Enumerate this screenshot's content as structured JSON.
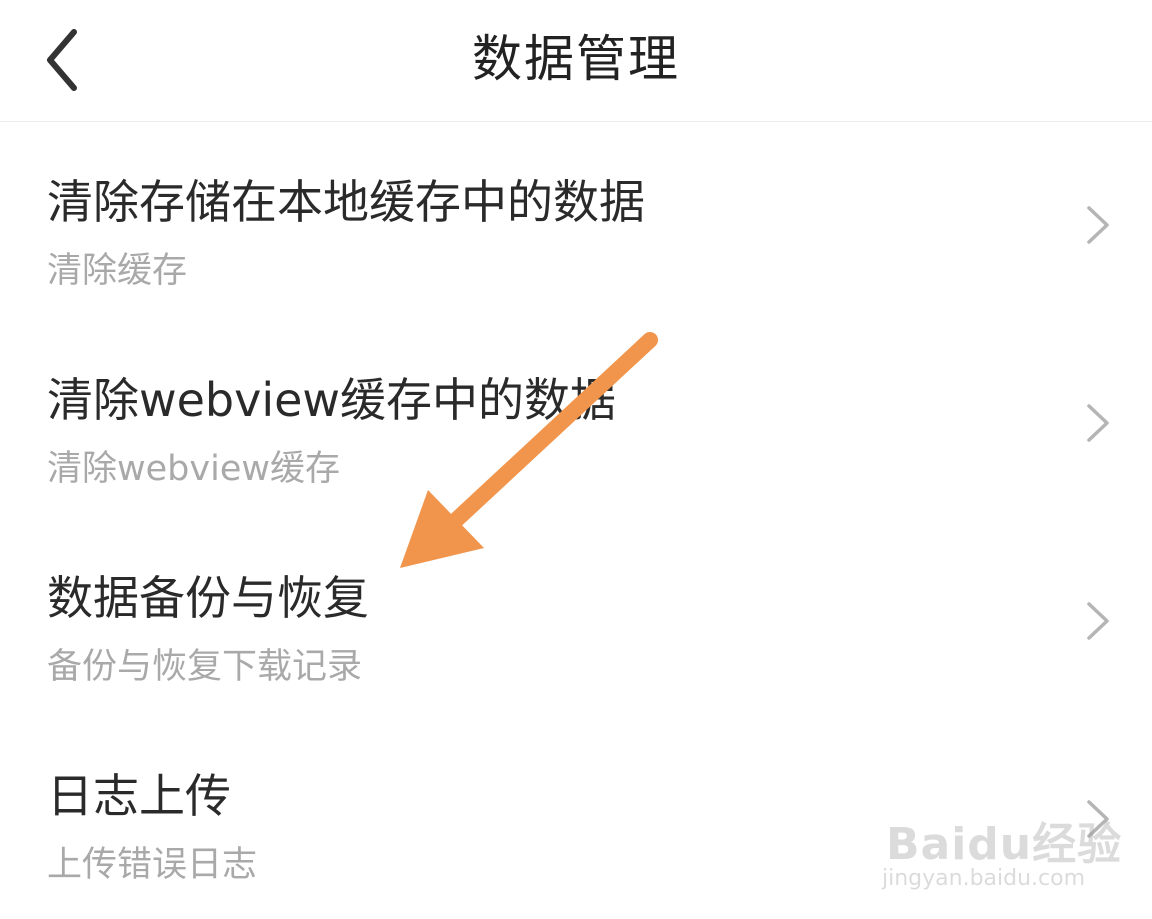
{
  "header": {
    "title": "数据管理",
    "back_icon": "chevron-left-icon"
  },
  "items": [
    {
      "title": "清除存储在本地缓存中的数据",
      "subtitle": "清除缓存",
      "icon": "chevron-right-icon"
    },
    {
      "title": "清除webview缓存中的数据",
      "subtitle": "清除webview缓存",
      "icon": "chevron-right-icon"
    },
    {
      "title": "数据备份与恢复",
      "subtitle": "备份与恢复下载记录",
      "icon": "chevron-right-icon"
    },
    {
      "title": "日志上传",
      "subtitle": "上传错误日志",
      "icon": "chevron-right-icon"
    }
  ],
  "annotation": {
    "arrow_color": "#f0954b"
  },
  "watermark": {
    "logo": "Baidu经验",
    "url": "jingyan.baidu.com"
  },
  "colors": {
    "title_text": "#222222",
    "item_title": "#2a2a2a",
    "item_subtitle": "#a9a9a9",
    "chevron": "#b5b5b5",
    "divider": "#ececec"
  }
}
